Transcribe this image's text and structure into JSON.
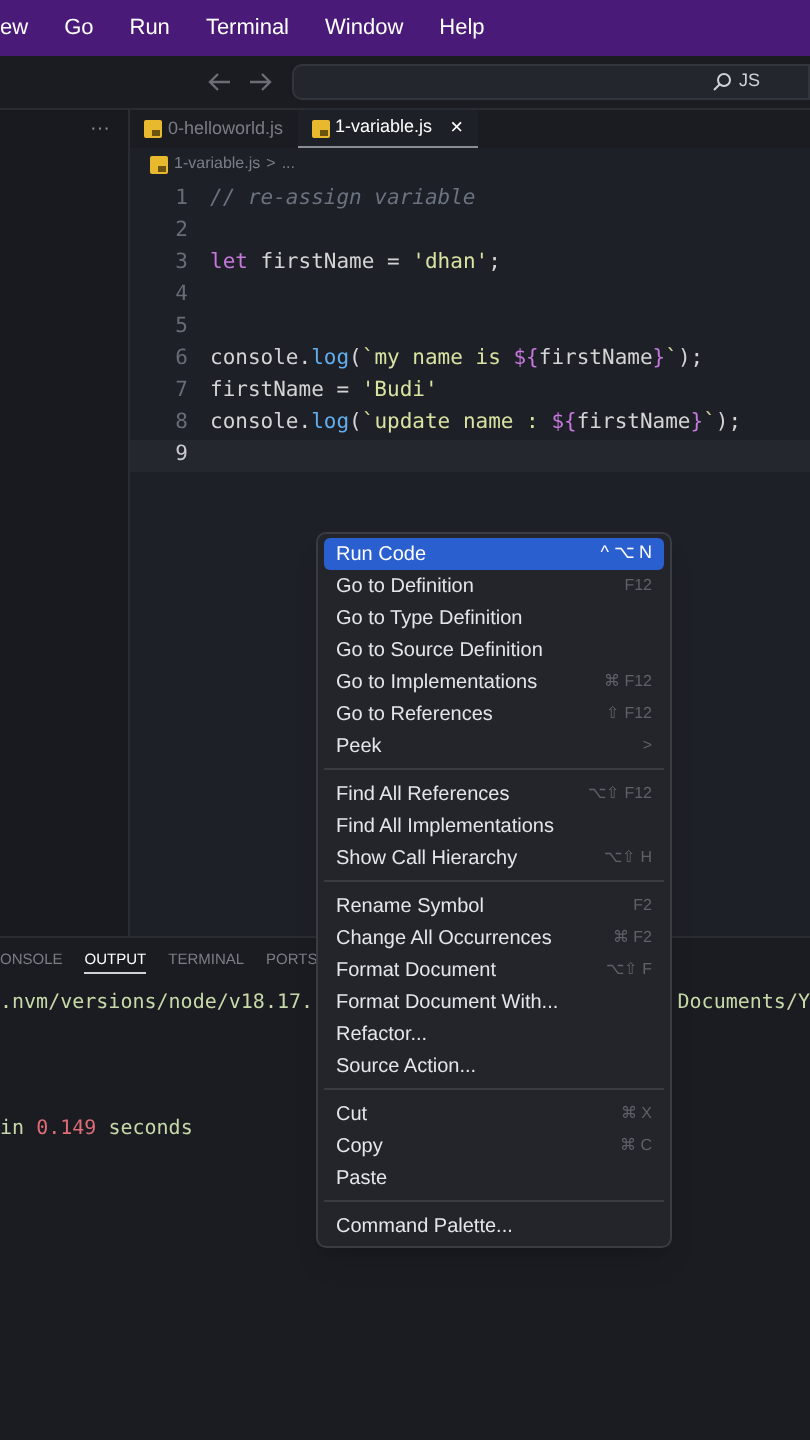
{
  "menu_bar": [
    "ew",
    "Go",
    "Run",
    "Terminal",
    "Window",
    "Help"
  ],
  "search": {
    "value": "JS"
  },
  "sidebar": {
    "more": "···"
  },
  "tabs": [
    {
      "label": "0-helloworld.js",
      "selected": false
    },
    {
      "label": "1-variable.js",
      "selected": true,
      "close": "×"
    }
  ],
  "breadcrumb": [
    "1-variable.js",
    ">",
    "..."
  ],
  "code": [
    {
      "number": "1",
      "current": false,
      "tokens": [
        {
          "text": "// re-assign variable",
          "kind": "comment"
        }
      ]
    },
    {
      "number": "2",
      "current": false
    },
    {
      "number": "3",
      "current": false,
      "tokens": [
        {
          "text": "let",
          "kind": "keyword"
        },
        {
          "text": " firstName = ",
          "kind": "plain"
        },
        {
          "text": "'dhan'",
          "kind": "string"
        },
        {
          "text": ";",
          "kind": "plain"
        }
      ]
    },
    {
      "number": "4",
      "current": false
    },
    {
      "number": "5",
      "current": false
    },
    {
      "number": "6",
      "current": false,
      "tokens": [
        {
          "text": "console.",
          "kind": "plain"
        },
        {
          "text": "log",
          "kind": "func"
        },
        {
          "text": "(",
          "kind": "plain"
        },
        {
          "text": "`my name is ",
          "kind": "string"
        },
        {
          "text": "${",
          "kind": "keyword"
        },
        {
          "text": "firstName",
          "kind": "plain"
        },
        {
          "text": "}",
          "kind": "keyword"
        },
        {
          "text": "`",
          "kind": "string"
        },
        {
          "text": ");",
          "kind": "plain"
        }
      ]
    },
    {
      "number": "7",
      "current": false,
      "tokens": [
        {
          "text": "firstName = ",
          "kind": "plain"
        },
        {
          "text": "'Budi'",
          "kind": "string"
        }
      ]
    },
    {
      "number": "8",
      "current": false,
      "tokens": [
        {
          "text": "console.",
          "kind": "plain"
        },
        {
          "text": "log",
          "kind": "func"
        },
        {
          "text": "(",
          "kind": "plain"
        },
        {
          "text": "`update name : ",
          "kind": "string"
        },
        {
          "text": "${",
          "kind": "keyword"
        },
        {
          "text": "firstName",
          "kind": "plain"
        },
        {
          "text": "}",
          "kind": "keyword"
        },
        {
          "text": "`",
          "kind": "string"
        },
        {
          "text": ");",
          "kind": "plain"
        }
      ]
    },
    {
      "number": "9",
      "current": true
    }
  ],
  "panel_tabs": [
    {
      "label": "ONSOLE",
      "selected": false
    },
    {
      "label": "OUTPUT",
      "selected": true
    },
    {
      "label": "TERMINAL",
      "selected": false
    },
    {
      "label": "PORTS",
      "selected": false
    }
  ],
  "output": {
    "path_left": ".nvm/versions/node/v18.17.",
    "path_right": "Documents/Y",
    "time_prefix": "in ",
    "time_value": "0.149",
    "time_suffix": " seconds"
  },
  "context_menu": [
    [
      {
        "label": "Run Code",
        "shortcut": "^ ⌥ N",
        "selected": true
      },
      {
        "label": "Go to Definition",
        "shortcut": "F12",
        "selected": false
      },
      {
        "label": "Go to Type Definition",
        "selected": false
      },
      {
        "label": "Go to Source Definition",
        "selected": false
      },
      {
        "label": "Go to Implementations",
        "shortcut": "⌘ F12",
        "selected": false
      },
      {
        "label": "Go to References",
        "shortcut": "⇧ F12",
        "selected": false
      },
      {
        "label": "Peek",
        "shortcut": ">",
        "selected": false
      }
    ],
    [
      {
        "label": "Find All References",
        "shortcut": "⌥⇧ F12",
        "selected": false
      },
      {
        "label": "Find All Implementations",
        "selected": false
      },
      {
        "label": "Show Call Hierarchy",
        "shortcut": "⌥⇧ H",
        "selected": false
      }
    ],
    [
      {
        "label": "Rename Symbol",
        "shortcut": "F2",
        "selected": false
      },
      {
        "label": "Change All Occurrences",
        "shortcut": "⌘ F2",
        "selected": false
      },
      {
        "label": "Format Document",
        "shortcut": "⌥⇧ F",
        "selected": false
      },
      {
        "label": "Format Document With...",
        "selected": false
      },
      {
        "label": "Refactor...",
        "selected": false
      },
      {
        "label": "Source Action...",
        "selected": false
      }
    ],
    [
      {
        "label": "Cut",
        "shortcut": "⌘ X",
        "selected": false
      },
      {
        "label": "Copy",
        "shortcut": "⌘ C",
        "selected": false
      },
      {
        "label": "Paste",
        "selected": false
      }
    ],
    [
      {
        "label": "Command Palette...",
        "selected": false
      }
    ]
  ]
}
